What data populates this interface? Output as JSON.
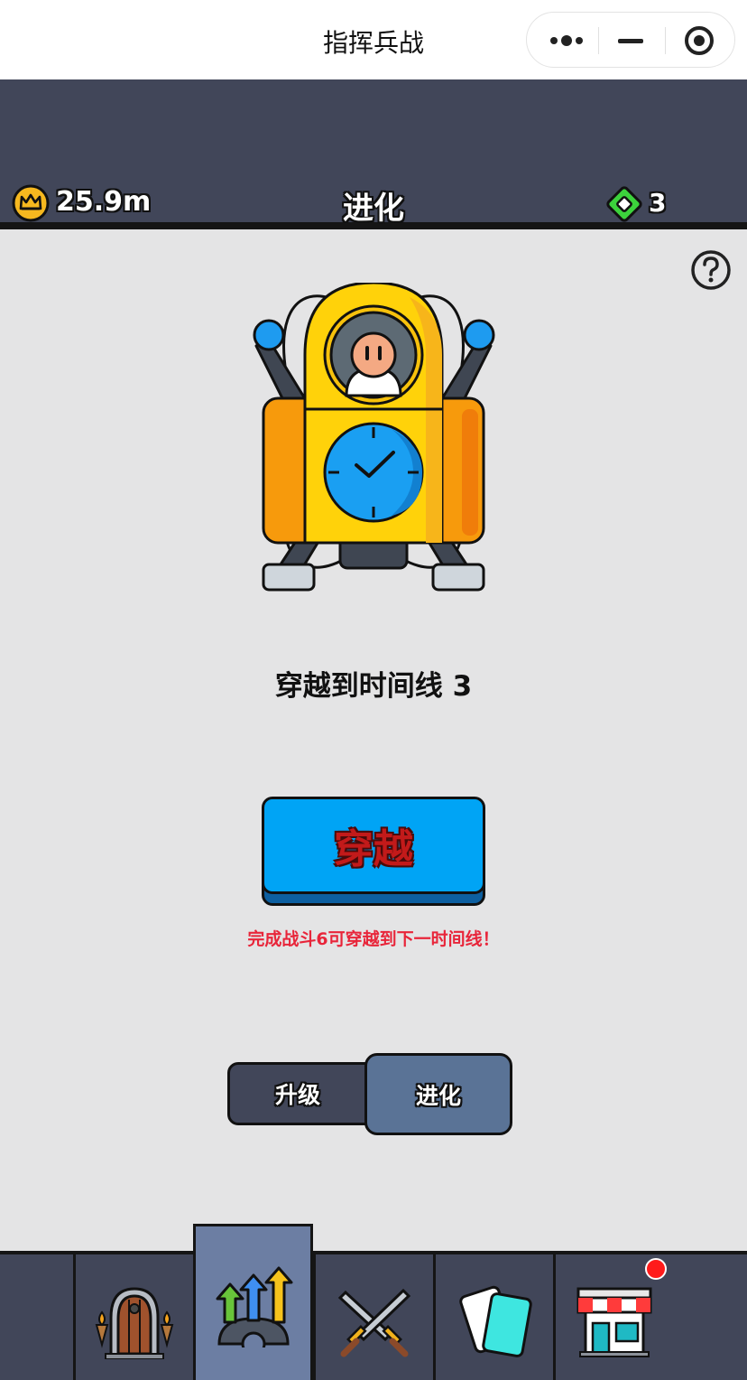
{
  "window": {
    "title": "指挥兵战"
  },
  "header": {
    "coins": "25.9m",
    "title": "进化",
    "gems": "3"
  },
  "main": {
    "timeline_text": "穿越到时间线 3",
    "travel_button": "穿越",
    "warning": "完成战斗6可穿越到下一时间线！"
  },
  "tabs": [
    {
      "label": "升级",
      "selected": false
    },
    {
      "label": "进化",
      "selected": true
    }
  ],
  "bottom_nav": [
    {
      "icon": "castle-door-icon",
      "active": false
    },
    {
      "icon": "evolve-arrows-icon",
      "active": true
    },
    {
      "icon": "crossed-swords-icon",
      "active": false
    },
    {
      "icon": "cards-icon",
      "active": false
    },
    {
      "icon": "shop-icon",
      "active": false,
      "badge": true
    }
  ],
  "colors": {
    "header_bg": "#414659",
    "content_bg": "#e4e4e5",
    "button_blue": "#00a4f5",
    "button_text": "#c21a1a",
    "warning_red": "#e8253a",
    "tab_selected": "#5a7396",
    "nav_active": "#6c7ea3"
  }
}
